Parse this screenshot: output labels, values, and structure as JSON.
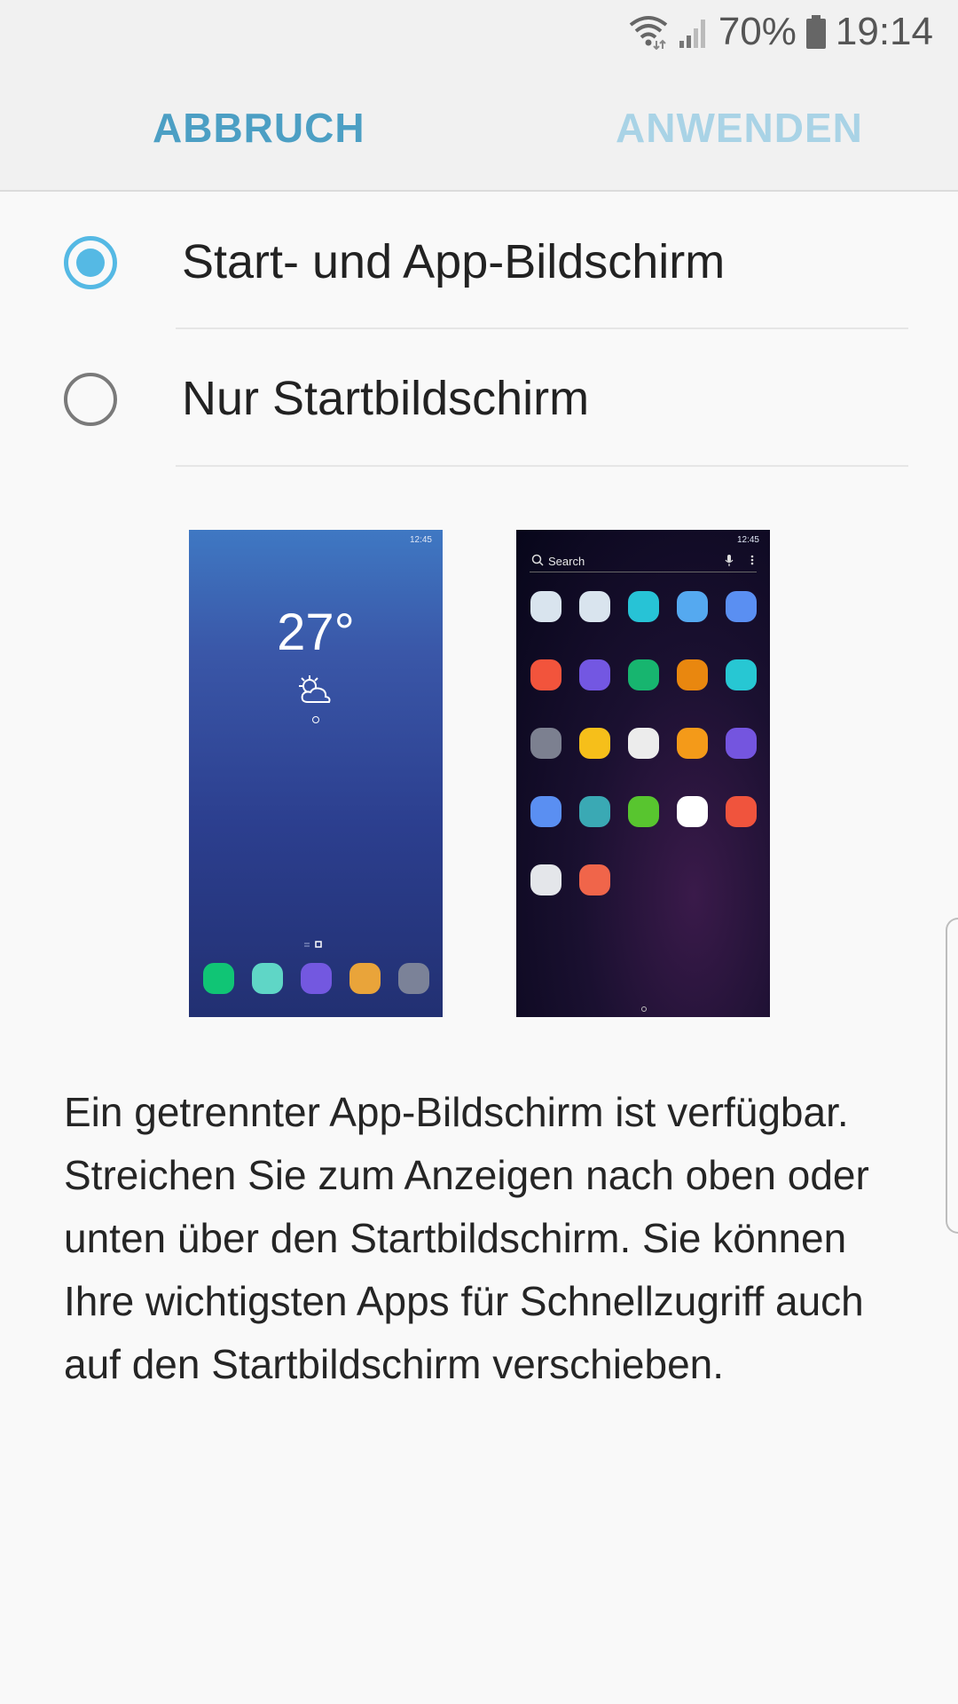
{
  "status_bar": {
    "battery_percent": "70%",
    "time": "19:14"
  },
  "app_bar": {
    "cancel_label": "ABBRUCH",
    "apply_label": "ANWENDEN"
  },
  "options": [
    {
      "label": "Start- und App-Bildschirm",
      "selected": true
    },
    {
      "label": "Nur Startbildschirm",
      "selected": false
    }
  ],
  "preview_home": {
    "status_time": "12:45",
    "temperature": "27°",
    "dock_icon_colors": [
      "#10c575",
      "#5fd6c6",
      "#7358e0",
      "#e9a43a",
      "#7b8298"
    ]
  },
  "preview_apps": {
    "status_time": "12:45",
    "search_placeholder": "Search",
    "app_icon_colors": [
      [
        "#d9e4ee",
        "#d9e4ee",
        "#27c3d6",
        "#55a9f0",
        "#5a8ff2"
      ],
      [
        "#f2543c",
        "#7357e2",
        "#17b56f",
        "#e9870f",
        "#27c7d3"
      ],
      [
        "#7c8090",
        "#f6bf1a",
        "#ececec",
        "#f49a19",
        "#7455df"
      ],
      [
        "#5a8ff2",
        "#3aa9b4",
        "#58c52f",
        "#ffffff",
        "#f0543d"
      ],
      [
        "#e4e6ea",
        "#f0654a"
      ]
    ]
  },
  "description": "Ein getrennter App-Bildschirm ist verfügbar. Streichen Sie zum Anzeigen nach oben oder unten über den Startbildschirm. Sie können Ihre wichtigsten Apps für Schnellzugriff auch auf den Startbildschirm verschieben.",
  "colors": {
    "accent": "#55b9e4",
    "cancel_text": "#4c9fc4",
    "apply_text_disabled": "#a9d3e6"
  }
}
